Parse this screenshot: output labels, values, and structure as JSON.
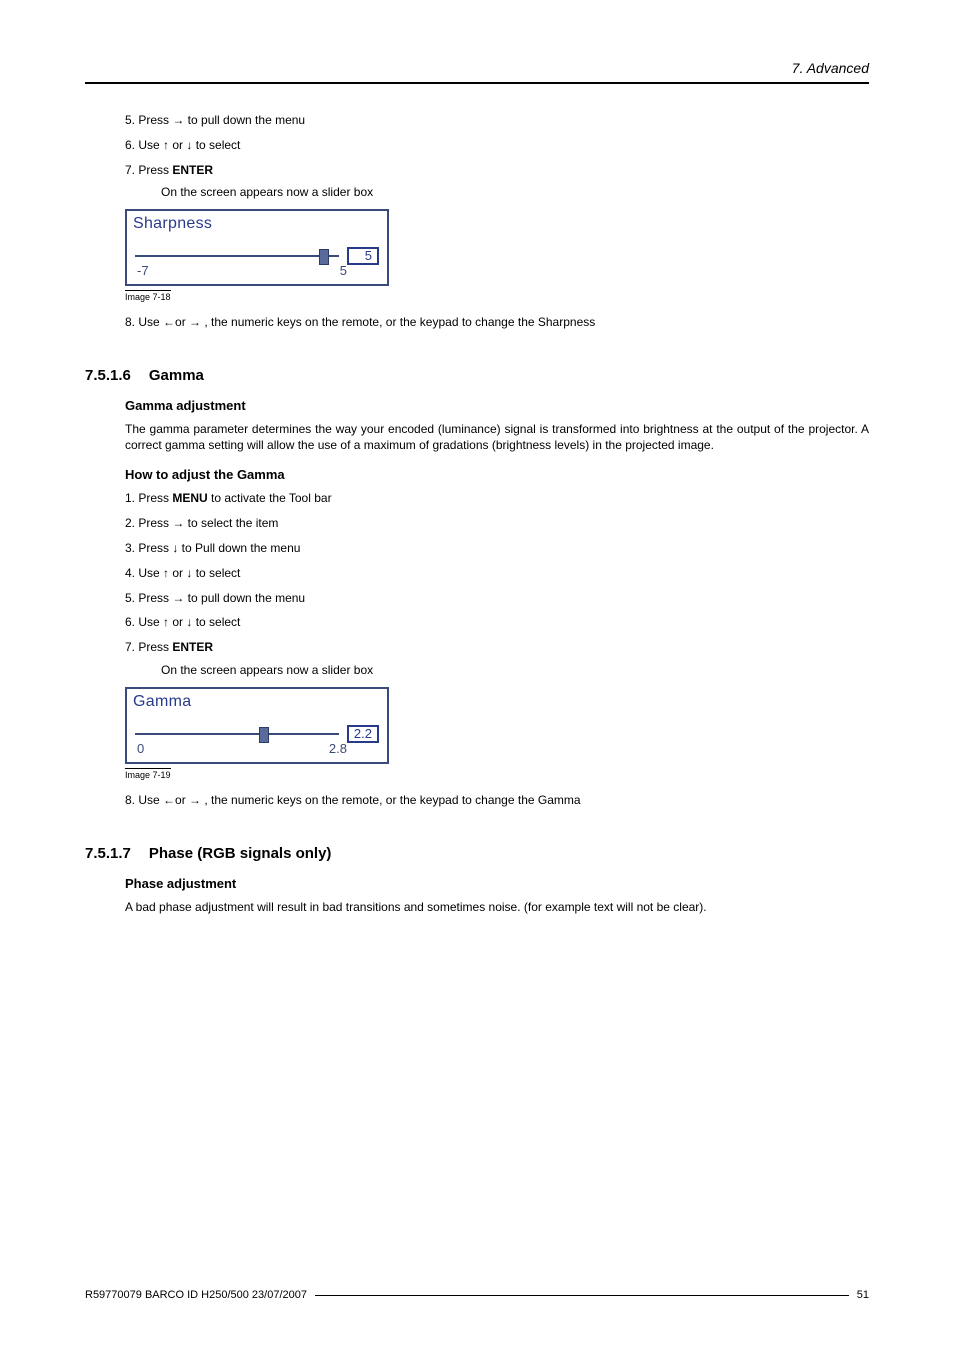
{
  "header": {
    "chapter": "7.  Advanced"
  },
  "top_steps": {
    "s5": "5.  Press → to pull down the menu",
    "s6": "6.  Use ↑ or ↓ to select",
    "s7_pre": "7.  Press ",
    "s7_bold": "ENTER",
    "s7_sub": "On the screen appears now a slider box"
  },
  "sharpness_slider": {
    "title": "Sharpness",
    "min": "-7",
    "max": "5",
    "value": "5",
    "thumb_pct": 90,
    "caption": "Image 7-18"
  },
  "top_step8": "8.  Use ←or → , the numeric keys on the remote, or the keypad to change the Sharpness",
  "gamma": {
    "heading_num": "7.5.1.6",
    "heading_txt": "Gamma",
    "sub1": "Gamma adjustment",
    "para": "The gamma parameter determines the way your encoded (luminance) signal is transformed into brightness at the output of the projector. A correct gamma setting will allow the use of a maximum of gradations (brightness levels) in the projected image.",
    "sub2": "How to adjust the Gamma",
    "steps": {
      "s1_pre": "1.  Press ",
      "s1_bold": "MENU",
      "s1_post": " to activate the Tool bar",
      "s2_pre": "2.  Press → to select the ",
      "s2_it": "",
      "s2_post": " item",
      "s3_pre": "3.  Press ↓ to Pull down the ",
      "s3_it": "",
      "s3_post": " menu",
      "s4": "4.  Use ↑ or ↓ to select",
      "s5": "5.  Press → to pull down the menu",
      "s6": "6.  Use ↑ or ↓ to select",
      "s7_pre": "7.  Press ",
      "s7_bold": "ENTER",
      "s7_sub": "On the screen appears now a slider box"
    }
  },
  "gamma_slider": {
    "title": "Gamma",
    "min": "0",
    "max": "2.8",
    "value": "2.2",
    "thumb_pct": 61,
    "caption": "Image 7-19"
  },
  "gamma_step8": "8.  Use ←or → , the numeric keys on the remote, or the keypad to change the Gamma",
  "phase": {
    "heading_num": "7.5.1.7",
    "heading_txt": "Phase (RGB signals only)",
    "sub1": "Phase adjustment",
    "para": "A bad phase adjustment will result in bad transitions and sometimes noise. (for example text will not be clear)."
  },
  "footer": {
    "left": "R59770079  BARCO ID H250/500  23/07/2007",
    "right": "51"
  }
}
